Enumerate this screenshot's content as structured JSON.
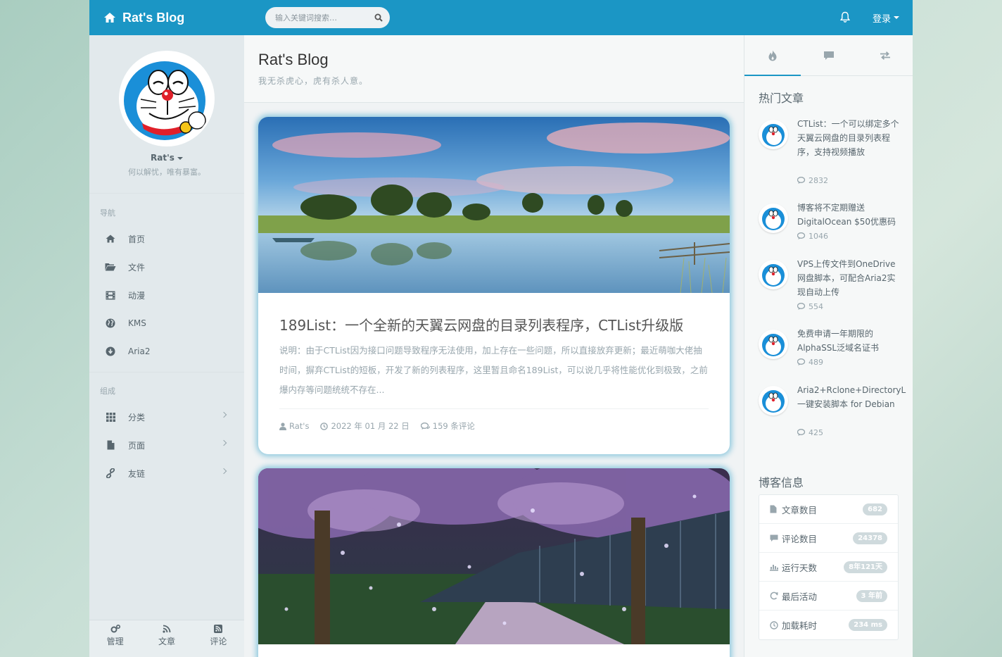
{
  "header": {
    "brand": "Rat's Blog",
    "search_placeholder": "输入关键词搜索…",
    "login_label": "登录"
  },
  "profile": {
    "name": "Rat's",
    "motto": "何以解忧，唯有暴富。"
  },
  "nav": {
    "section_label": "导航",
    "items": [
      {
        "label": "首页",
        "icon": "home-icon"
      },
      {
        "label": "文件",
        "icon": "folder-open-icon"
      },
      {
        "label": "动漫",
        "icon": "film-icon"
      },
      {
        "label": "KMS",
        "icon": "globe-icon"
      },
      {
        "label": "Aria2",
        "icon": "download-circle-icon"
      }
    ]
  },
  "compose": {
    "section_label": "组成",
    "items": [
      {
        "label": "分类",
        "icon": "grid-icon"
      },
      {
        "label": "页面",
        "icon": "file-icon"
      },
      {
        "label": "友链",
        "icon": "link-icon"
      }
    ]
  },
  "aside_footer": {
    "items": [
      {
        "label": "管理",
        "icon": "cogs-icon"
      },
      {
        "label": "文章",
        "icon": "rss-icon"
      },
      {
        "label": "评论",
        "icon": "rss-square-icon"
      }
    ]
  },
  "main": {
    "title": "Rat's Blog",
    "subtitle": "我无杀虎心，虎有杀人意。"
  },
  "posts": [
    {
      "title": "189List：一个全新的天翼云网盘的目录列表程序，CTList升级版",
      "excerpt": "说明：由于CTList因为接口问题导致程序无法使用，加上存在一些问题，所以直接放弃更新；最近萌咖大佬抽时间，摒弃CTList的短板，开发了新的列表程序，这里暂且命名189List，可以说几乎将性能优化到极致，之前爆内存等问题统统不存在...",
      "author": "Rat's",
      "date": "2022 年 01 月 22 日",
      "comments": "159 条评论"
    }
  ],
  "right": {
    "tabs": [
      "fire-icon",
      "comment-icon",
      "exchange-icon"
    ],
    "hot_title": "热门文章",
    "hot": [
      {
        "title": "CTList：一个可以绑定多个天翼云网盘的目录列表程序，支持视频播放",
        "count": "2832"
      },
      {
        "title": "博客将不定期赠送DigitalOcean $50优惠码",
        "count": "1046"
      },
      {
        "title": "VPS上传文件到OneDrive网盘脚本，可配合Aria2实现自动上传",
        "count": "554"
      },
      {
        "title": "免费申请一年期限的AlphaSSL泛域名证书",
        "count": "489"
      },
      {
        "title": "Aria2+Rclone+DirectoryL一键安装脚本 for Debian",
        "count": "425"
      }
    ],
    "info_title": "博客信息",
    "info": [
      {
        "label": "文章数目",
        "value": "682",
        "icon": "file-icon"
      },
      {
        "label": "评论数目",
        "value": "24378",
        "icon": "comment-icon"
      },
      {
        "label": "运行天数",
        "value": "8年121天",
        "icon": "bar-chart-icon"
      },
      {
        "label": "最后活动",
        "value": "3 年前",
        "icon": "refresh-icon"
      },
      {
        "label": "加载耗时",
        "value": "234 ms",
        "icon": "clock-icon"
      }
    ]
  },
  "colors": {
    "brand": "#1b96c5",
    "aside_bg": "#e2e9ec",
    "text": "#58666e",
    "muted": "#98a6ad"
  }
}
